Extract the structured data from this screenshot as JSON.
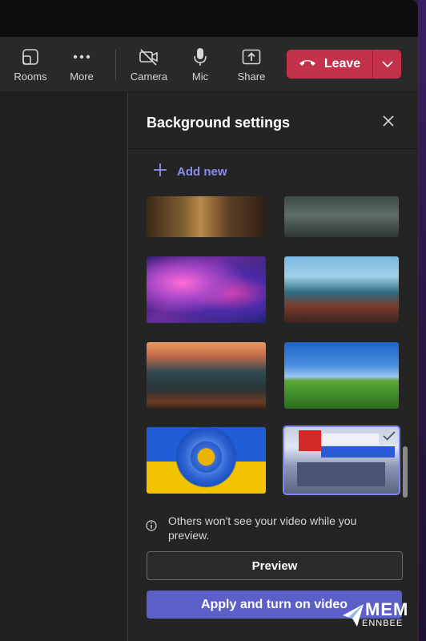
{
  "toolbar": {
    "rooms_label": "Rooms",
    "more_label": "More",
    "camera_label": "Camera",
    "mic_label": "Mic",
    "share_label": "Share",
    "leave_label": "Leave"
  },
  "panel": {
    "title": "Background settings",
    "add_new_label": "Add new",
    "info_text": "Others won't see your video while you preview.",
    "preview_label": "Preview",
    "apply_label": "Apply and turn on video"
  },
  "watermark": {
    "line1": "MEM",
    "line2": "ENNBEE"
  },
  "colors": {
    "leave": "#c4314b",
    "accent": "#5b5fc7",
    "link": "#8b8cf0"
  },
  "icons": [
    "rooms-icon",
    "more-icon",
    "camera-off-icon",
    "mic-icon",
    "share-icon",
    "phone-hangup-icon",
    "chevron-down-icon",
    "close-icon",
    "plus-icon",
    "info-icon",
    "checkmark-icon"
  ]
}
